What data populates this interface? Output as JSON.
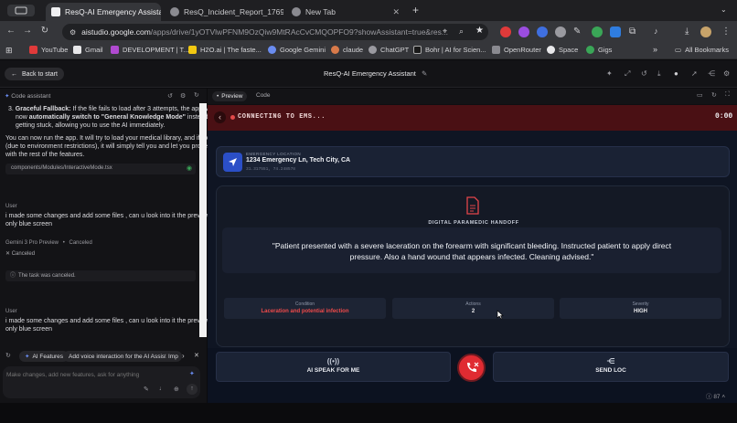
{
  "browser": {
    "tabs": [
      {
        "title": "ResQ-AI Emergency Assistant",
        "active": true
      },
      {
        "title": "ResQ_Incident_Report_1769",
        "active": false
      },
      {
        "title": "New Tab",
        "active": false
      }
    ],
    "new_tab": "+",
    "url_host": "aistudio.google.com",
    "url_path": "/apps/drive/1yOTVlwPFNM9OzQiw9MtRAcCvCMQOPFO9?showAssistant=true&res...",
    "bookmarks": [
      "YouTube",
      "Gmail",
      "DEVELOPMENT | T...",
      "H2O.ai | The faste...",
      "Google Gemini",
      "claude",
      "ChatGPT",
      "Bohr | AI for Scien...",
      "OpenRouter",
      "Space",
      "Gigs"
    ],
    "all_bookmarks": "All Bookmarks",
    "more": "»"
  },
  "app": {
    "back_label": "Back to start",
    "title": "ResQ-AI Emergency Assistant"
  },
  "assistant": {
    "panel_title": "Code assistant",
    "msg1_line1_bold": "Graceful Fallback:",
    "msg1_line1_rest": " If the file fails to load after 3 attempts, the app will",
    "msg1_line2_pre": "now ",
    "msg1_line2_bold": "automatically switch to \"General Knowledge Mode\"",
    "msg1_line2_rest": " instead of",
    "msg1_line3": "getting stuck, allowing you to use the AI immediately.",
    "msg1_num": "3.",
    "para1_l1": "You can now run the app. It will try to load your medical library, and if it can't",
    "para1_l2": "(due to environment restrictions), it will simply tell you and let you proceed",
    "para1_l3": "with the rest of the features.",
    "file_ref": "components/Modules/InteractiveMode.tsx",
    "user_label": "User",
    "user_msg_l1": "i made some changes and add some files , can u look into it the preview s",
    "user_msg_l2": "only blue screen",
    "model_label": "Gemini 3 Pro Preview",
    "model_status": "Canceled",
    "canceled_label": "Canceled",
    "task_canceled": "The task was canceled.",
    "user_label2": "User",
    "user_msg2_l1": "i made some changes and add some files , can u look into it the preview s",
    "user_msg2_l2": "only blue screen",
    "chips": [
      "AI Features",
      "Add voice interaction for the AI Assistant.",
      "Imp"
    ],
    "composer_placeholder": "Make changes, add new features, ask for anything"
  },
  "preview": {
    "tab_preview": "Preview",
    "tab_code": "Code",
    "status": "CONNECTING TO EMS...",
    "timer": "0:00",
    "location_label": "EMERGENCY LOCATION",
    "location_address": "1234 Emergency Ln, Tech City, CA",
    "location_coords": "31.317551, 74.248578",
    "handoff_title": "DIGITAL PARAMEDIC HANDOFF",
    "handoff_quote_l1": "\"Patient presented with a severe laceration on the forearm with significant bleeding. Instructed patient to apply direct",
    "handoff_quote_l2": "pressure. Also a hand wound that appears infected. Cleaning advised.\"",
    "stats": [
      {
        "label": "Condition",
        "value": "Laceration and potential infection",
        "color": "#ef4a4a"
      },
      {
        "label": "Actions",
        "value": "2",
        "color": "#e8eaf0"
      },
      {
        "label": "Severity",
        "value": "HIGH",
        "color": "#e8eaf0"
      }
    ],
    "btn_speak": "AI SPEAK FOR ME",
    "btn_send": "SEND LOC",
    "zoom": "87"
  },
  "colors": {
    "accent_blue": "#3b6bf5",
    "ems_red": "#e02b32",
    "bg_dark": "#0f1523"
  }
}
